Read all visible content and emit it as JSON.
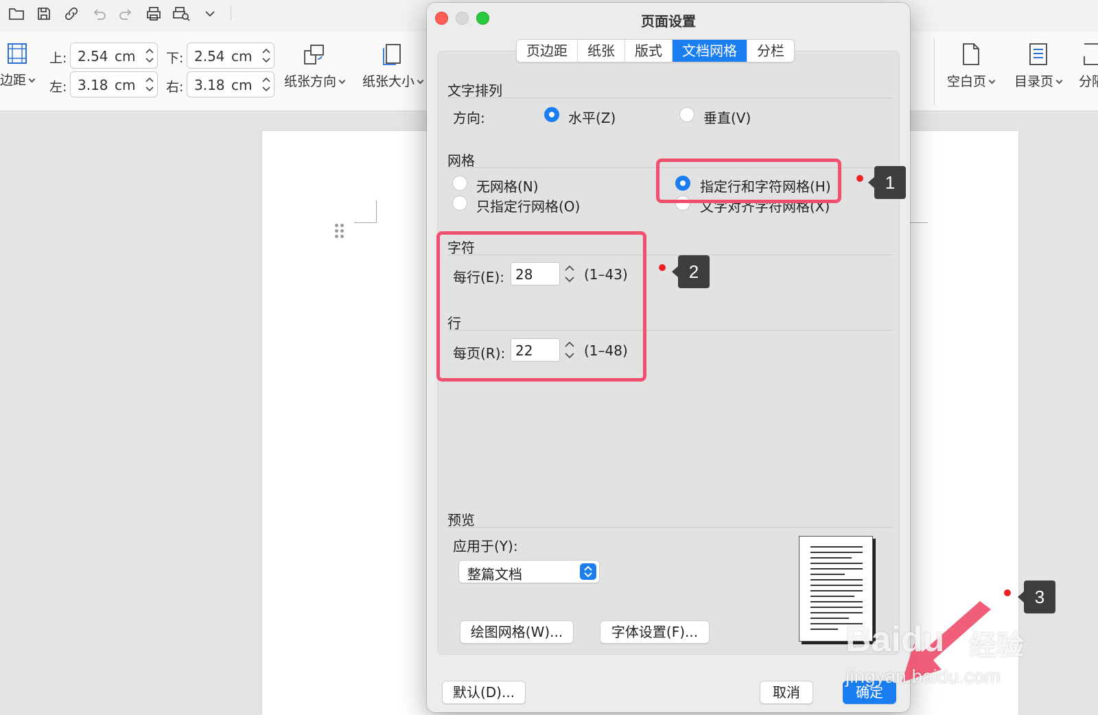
{
  "quick_access": {
    "icons": [
      "folder-icon",
      "save-icon",
      "link-icon",
      "undo-icon",
      "redo-icon",
      "print-icon",
      "print-preview-icon",
      "chevron-down-icon"
    ]
  },
  "ribbon": {
    "margin_button": "边距",
    "top_label": "上:",
    "top_value": "2.54",
    "top_unit": "cm",
    "bottom_label": "下:",
    "bottom_value": "2.54",
    "bottom_unit": "cm",
    "left_label": "左:",
    "left_value": "3.18",
    "left_unit": "cm",
    "right_label": "右:",
    "right_value": "3.18",
    "right_unit": "cm",
    "orientation_button": "纸张方向",
    "size_button": "纸张大小",
    "blank_page_button": "空白页",
    "toc_page_button": "目录页",
    "section_button": "分隔"
  },
  "dialog": {
    "title": "页面设置",
    "tabs": [
      {
        "label": "页边距",
        "active": false
      },
      {
        "label": "纸张",
        "active": false
      },
      {
        "label": "版式",
        "active": false
      },
      {
        "label": "文档网格",
        "active": true
      },
      {
        "label": "分栏",
        "active": false
      }
    ],
    "text_layout": {
      "section_title": "文字排列",
      "direction_label": "方向:",
      "horizontal_label": "水平(Z)",
      "vertical_label": "垂直(V)",
      "selected": "horizontal"
    },
    "grid": {
      "section_title": "网格",
      "no_grid_label": "无网格(N)",
      "line_grid_only_label": "只指定行网格(O)",
      "line_and_char_grid_label": "指定行和字符网格(H)",
      "snap_to_char_grid_label": "文字对齐字符网格(X)",
      "selected": "line_and_char_grid"
    },
    "characters": {
      "section_title": "字符",
      "per_line_label": "每行(E):",
      "per_line_value": "28",
      "per_line_range": "(1–43)"
    },
    "lines": {
      "section_title": "行",
      "per_page_label": "每页(R):",
      "per_page_value": "22",
      "per_page_range": "(1–48)"
    },
    "preview": {
      "section_title": "预览",
      "apply_to_label": "应用于(Y):",
      "apply_to_value": "整篇文档"
    },
    "draw_grid_button": "绘图网格(W)...",
    "font_settings_button": "字体设置(F)...",
    "default_button": "默认(D)...",
    "cancel_button": "取消",
    "ok_button": "确定"
  },
  "annotations": {
    "step1": "1",
    "step2": "2",
    "step3": "3",
    "highlight_color": "#f0506e",
    "dot_color": "#ee2222"
  },
  "watermark": {
    "logo": "Baidu",
    "cn": "经验",
    "url": "jingyan.baidu.com"
  },
  "colors": {
    "accent": "#1a7ef0",
    "dialog_bg": "#ececec"
  }
}
